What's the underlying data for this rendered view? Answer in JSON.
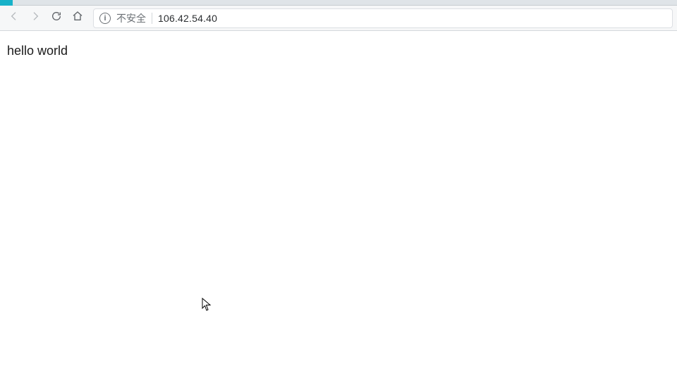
{
  "tabstrip": {
    "active_tab_color": "#17b2c9"
  },
  "toolbar": {
    "back_icon": "back-arrow",
    "forward_icon": "forward-arrow",
    "reload_icon": "reload",
    "home_icon": "home"
  },
  "omnibox": {
    "security_icon": "info",
    "security_label": "不安全",
    "url": "106.42.54.40"
  },
  "page": {
    "body_text": "hello world"
  }
}
